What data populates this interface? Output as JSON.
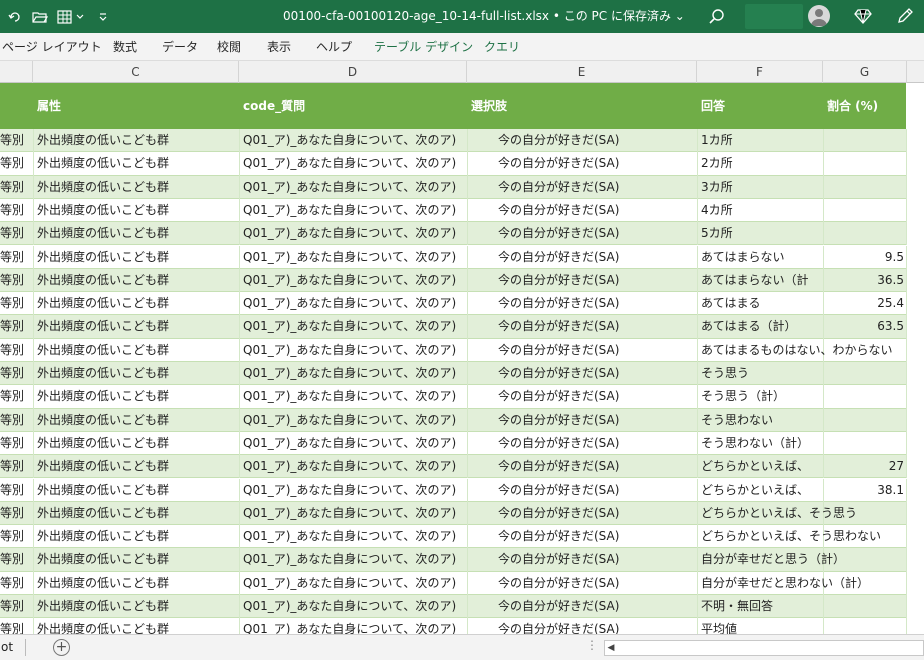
{
  "window": {
    "title": "00100-cfa-00100120-age_10-14-full-list.xlsx • この PC に保存済み ⌄"
  },
  "ribbon_tabs": [
    {
      "label": "ページ レイアウト"
    },
    {
      "label": "数式"
    },
    {
      "label": "データ"
    },
    {
      "label": "校閲"
    },
    {
      "label": "表示"
    },
    {
      "label": "ヘルプ"
    },
    {
      "label": "テーブル デザイン"
    },
    {
      "label": "クエリ"
    }
  ],
  "column_letters": [
    "C",
    "D",
    "E",
    "F",
    "G"
  ],
  "table": {
    "headers": [
      "属性",
      "code_質問",
      "選択肢",
      "回答",
      "割合 (%)"
    ],
    "rows": [
      {
        "a": "等別",
        "c": "外出頻度の低いこども群",
        "d": "Q01_ア)_あなた自身について、次のア)",
        "e": "今の自分が好きだ(SA)",
        "f": "1カ所",
        "g": ""
      },
      {
        "a": "等別",
        "c": "外出頻度の低いこども群",
        "d": "Q01_ア)_あなた自身について、次のア)",
        "e": "今の自分が好きだ(SA)",
        "f": "2カ所",
        "g": ""
      },
      {
        "a": "等別",
        "c": "外出頻度の低いこども群",
        "d": "Q01_ア)_あなた自身について、次のア)",
        "e": "今の自分が好きだ(SA)",
        "f": "3カ所",
        "g": ""
      },
      {
        "a": "等別",
        "c": "外出頻度の低いこども群",
        "d": "Q01_ア)_あなた自身について、次のア)",
        "e": "今の自分が好きだ(SA)",
        "f": "4カ所",
        "g": ""
      },
      {
        "a": "等別",
        "c": "外出頻度の低いこども群",
        "d": "Q01_ア)_あなた自身について、次のア)",
        "e": "今の自分が好きだ(SA)",
        "f": "5カ所",
        "g": ""
      },
      {
        "a": "等別",
        "c": "外出頻度の低いこども群",
        "d": "Q01_ア)_あなた自身について、次のア)",
        "e": "今の自分が好きだ(SA)",
        "f": "あてはまらない",
        "g": "9.5"
      },
      {
        "a": "等別",
        "c": "外出頻度の低いこども群",
        "d": "Q01_ア)_あなた自身について、次のア)",
        "e": "今の自分が好きだ(SA)",
        "f": "あてはまらない（計",
        "g": "36.5"
      },
      {
        "a": "等別",
        "c": "外出頻度の低いこども群",
        "d": "Q01_ア)_あなた自身について、次のア)",
        "e": "今の自分が好きだ(SA)",
        "f": "あてはまる",
        "g": "25.4"
      },
      {
        "a": "等別",
        "c": "外出頻度の低いこども群",
        "d": "Q01_ア)_あなた自身について、次のア)",
        "e": "今の自分が好きだ(SA)",
        "f": "あてはまる（計）",
        "g": "63.5"
      },
      {
        "a": "等別",
        "c": "外出頻度の低いこども群",
        "d": "Q01_ア)_あなた自身について、次のア)",
        "e": "今の自分が好きだ(SA)",
        "f": "あてはまるものはない、わからない",
        "g": ""
      },
      {
        "a": "等別",
        "c": "外出頻度の低いこども群",
        "d": "Q01_ア)_あなた自身について、次のア)",
        "e": "今の自分が好きだ(SA)",
        "f": "そう思う",
        "g": ""
      },
      {
        "a": "等別",
        "c": "外出頻度の低いこども群",
        "d": "Q01_ア)_あなた自身について、次のア)",
        "e": "今の自分が好きだ(SA)",
        "f": "そう思う（計）",
        "g": ""
      },
      {
        "a": "等別",
        "c": "外出頻度の低いこども群",
        "d": "Q01_ア)_あなた自身について、次のア)",
        "e": "今の自分が好きだ(SA)",
        "f": "そう思わない",
        "g": ""
      },
      {
        "a": "等別",
        "c": "外出頻度の低いこども群",
        "d": "Q01_ア)_あなた自身について、次のア)",
        "e": "今の自分が好きだ(SA)",
        "f": "そう思わない（計）",
        "g": ""
      },
      {
        "a": "等別",
        "c": "外出頻度の低いこども群",
        "d": "Q01_ア)_あなた自身について、次のア)",
        "e": "今の自分が好きだ(SA)",
        "f": "どちらかといえば、",
        "g": "27"
      },
      {
        "a": "等別",
        "c": "外出頻度の低いこども群",
        "d": "Q01_ア)_あなた自身について、次のア)",
        "e": "今の自分が好きだ(SA)",
        "f": "どちらかといえば、",
        "g": "38.1"
      },
      {
        "a": "等別",
        "c": "外出頻度の低いこども群",
        "d": "Q01_ア)_あなた自身について、次のア)",
        "e": "今の自分が好きだ(SA)",
        "f": "どちらかといえば、そう思う",
        "g": ""
      },
      {
        "a": "等別",
        "c": "外出頻度の低いこども群",
        "d": "Q01_ア)_あなた自身について、次のア)",
        "e": "今の自分が好きだ(SA)",
        "f": "どちらかといえば、そう思わない",
        "g": ""
      },
      {
        "a": "等別",
        "c": "外出頻度の低いこども群",
        "d": "Q01_ア)_あなた自身について、次のア)",
        "e": "今の自分が好きだ(SA)",
        "f": "自分が幸せだと思う（計）",
        "g": ""
      },
      {
        "a": "等別",
        "c": "外出頻度の低いこども群",
        "d": "Q01_ア)_あなた自身について、次のア)",
        "e": "今の自分が好きだ(SA)",
        "f": "自分が幸せだと思わない（計）",
        "g": ""
      },
      {
        "a": "等別",
        "c": "外出頻度の低いこども群",
        "d": "Q01_ア)_あなた自身について、次のア)",
        "e": "今の自分が好きだ(SA)",
        "f": "不明・無回答",
        "g": ""
      },
      {
        "a": "等別",
        "c": "外出頻度の低いこども群",
        "d": "Q01_ア)_あなた自身について、次のア)",
        "e": "今の自分が好きだ(SA)",
        "f": "平均値",
        "g": ""
      }
    ]
  },
  "sheetbar": {
    "sheet_tab": "ot",
    "add_sheet": "+",
    "dots": "⋮",
    "scroll_left": "◀"
  },
  "icons": {
    "title_left": [
      "undo-icon",
      "open-folder-icon",
      "table-format-icon",
      "chevron-down-icon",
      "customize-qat-icon"
    ],
    "title_right": [
      "search-icon",
      "avatar",
      "diamond-icon",
      "pen-icon"
    ]
  },
  "colors": {
    "titlebar": "#1e7145",
    "table_header": "#70ad47",
    "band": "#e2efd9"
  }
}
